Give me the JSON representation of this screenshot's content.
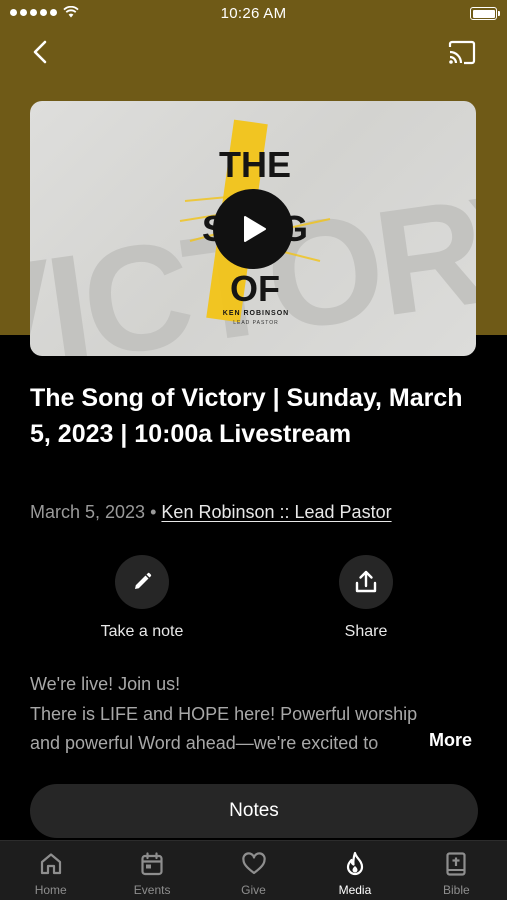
{
  "status_bar": {
    "time": "10:26 AM"
  },
  "nav": {
    "back_icon": "chevron-left-icon",
    "cast_icon": "cast-icon"
  },
  "media": {
    "thumbnail": {
      "background_word": "VICTORY",
      "title_lines": [
        "THE",
        "SONG",
        "OF"
      ],
      "speaker": "KEN ROBINSON",
      "speaker_role": "LEAD PASTOR",
      "accent_color": "#f2c418"
    },
    "title": "The Song of Victory | Sunday, March 5, 2023 | 10:00a Livestream",
    "date": "March 5, 2023",
    "separator": "•",
    "author": "Ken Robinson :: Lead Pastor"
  },
  "actions": {
    "note_label": "Take a note",
    "share_label": "Share"
  },
  "description": {
    "line1": "We're live! Join us!",
    "line2": "There is LIFE and HOPE here! Powerful worship",
    "line3": "and powerful Word ahead—we're excited to",
    "more_label": "More"
  },
  "notes_button": "Notes",
  "tabs": [
    {
      "label": "Home",
      "icon": "home-icon",
      "active": false
    },
    {
      "label": "Events",
      "icon": "calendar-icon",
      "active": false
    },
    {
      "label": "Give",
      "icon": "heart-icon",
      "active": false
    },
    {
      "label": "Media",
      "icon": "flame-icon",
      "active": true
    },
    {
      "label": "Bible",
      "icon": "bible-icon",
      "active": false
    }
  ],
  "colors": {
    "hero_background": "#6f5a17",
    "page_background": "#000000",
    "button_background": "#262626"
  }
}
